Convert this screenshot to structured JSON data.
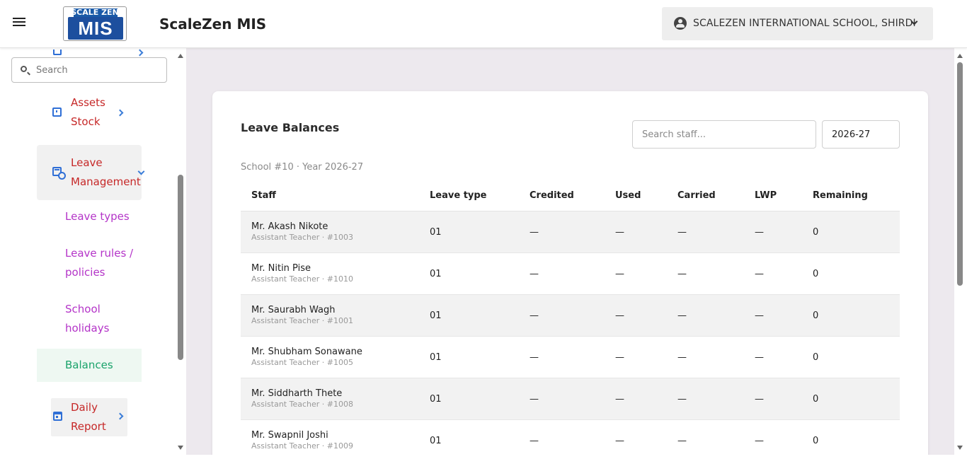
{
  "header": {
    "logo_text_top": "SCALE ZEN",
    "logo_text_main": "MIS",
    "app_title": "ScaleZen MIS",
    "school_name": "SCALEZEN INTERNATIONAL SCHOOL, SHIRDI"
  },
  "sidebar": {
    "search_placeholder": "Search",
    "assets": {
      "line1": "Assets",
      "line2": "Stock"
    },
    "leave_management": {
      "line1": "Leave",
      "line2": "Management"
    },
    "sub_items": {
      "leave_types": "Leave types",
      "leave_rules_1": "Leave rules /",
      "leave_rules_2": "policies",
      "holidays_1": "School",
      "holidays_2": "holidays",
      "balances": "Balances"
    },
    "daily_report": {
      "line1": "Daily",
      "line2": "Report"
    }
  },
  "main": {
    "title": "Leave Balances",
    "staff_search_placeholder": "Search staff...",
    "year_value": "2026-27",
    "subtitle": "School #10 · Year 2026-27",
    "columns": {
      "staff": "Staff",
      "leave_type": "Leave type",
      "credited": "Credited",
      "used": "Used",
      "carried": "Carried",
      "lwp": "LWP",
      "remaining": "Remaining"
    },
    "rows": [
      {
        "name": "Mr. Akash Nikote",
        "sub": "Assistant Teacher · #1003",
        "leave_type": "01",
        "credited": "—",
        "used": "—",
        "carried": "—",
        "lwp": "—",
        "remaining": "0"
      },
      {
        "name": "Mr. Nitin Pise",
        "sub": "Assistant Teacher · #1010",
        "leave_type": "01",
        "credited": "—",
        "used": "—",
        "carried": "—",
        "lwp": "—",
        "remaining": "0"
      },
      {
        "name": "Mr. Saurabh Wagh",
        "sub": "Assistant Teacher · #1001",
        "leave_type": "01",
        "credited": "—",
        "used": "—",
        "carried": "—",
        "lwp": "—",
        "remaining": "0"
      },
      {
        "name": "Mr. Shubham Sonawane",
        "sub": "Assistant Teacher · #1005",
        "leave_type": "01",
        "credited": "—",
        "used": "—",
        "carried": "—",
        "lwp": "—",
        "remaining": "0"
      },
      {
        "name": "Mr. Siddharth Thete",
        "sub": "Assistant Teacher · #1008",
        "leave_type": "01",
        "credited": "—",
        "used": "—",
        "carried": "—",
        "lwp": "—",
        "remaining": "0"
      },
      {
        "name": "Mr. Swapnil Joshi",
        "sub": "Assistant Teacher · #1009",
        "leave_type": "01",
        "credited": "—",
        "used": "—",
        "carried": "—",
        "lwp": "—",
        "remaining": "0"
      }
    ]
  },
  "colors": {
    "nav_red": "#c62828",
    "sub_purple": "#b434c8",
    "active_green": "#1aa36b",
    "icon_blue": "#2f6fd6",
    "main_bg": "#ede9ee"
  }
}
